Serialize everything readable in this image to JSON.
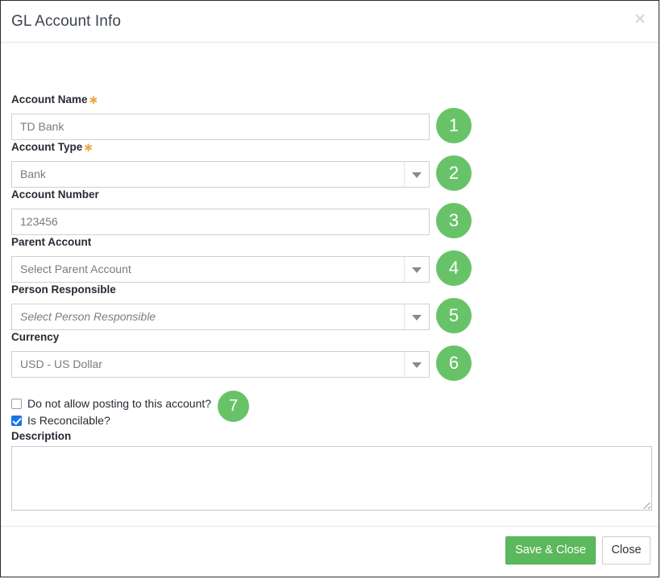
{
  "dialog": {
    "title": "GL Account Info",
    "close_icon": "close-icon"
  },
  "fields": [
    {
      "label": "Account Name",
      "required": true,
      "type": "text",
      "value": "TD Bank",
      "badge": "1"
    },
    {
      "label": "Account Type",
      "required": true,
      "type": "select",
      "value": "Bank",
      "badge": "2"
    },
    {
      "label": "Account Number",
      "required": false,
      "type": "text",
      "value": "123456",
      "badge": "3"
    },
    {
      "label": "Parent Account",
      "required": false,
      "type": "select",
      "value": "Select Parent Account",
      "badge": "4"
    },
    {
      "label": "Person Responsible",
      "required": false,
      "type": "select",
      "value": "Select Person Responsible",
      "badge": "5"
    },
    {
      "label": "Currency",
      "required": false,
      "type": "select",
      "value": "USD - US Dollar",
      "badge": "6"
    }
  ],
  "checkboxes": {
    "badge": "7",
    "items": [
      {
        "label": "Do not allow posting to this account?",
        "checked": false
      },
      {
        "label": "Is Reconcilable?",
        "checked": true
      }
    ]
  },
  "description": {
    "label": "Description",
    "value": "",
    "placeholder": ""
  },
  "footer": {
    "save_label": "Save & Close",
    "close_label": "Close"
  },
  "colors": {
    "badge_green": "#68c368",
    "button_green": "#5cb85c",
    "required_orange": "#f0a848",
    "checkbox_blue": "#1a73e8"
  }
}
